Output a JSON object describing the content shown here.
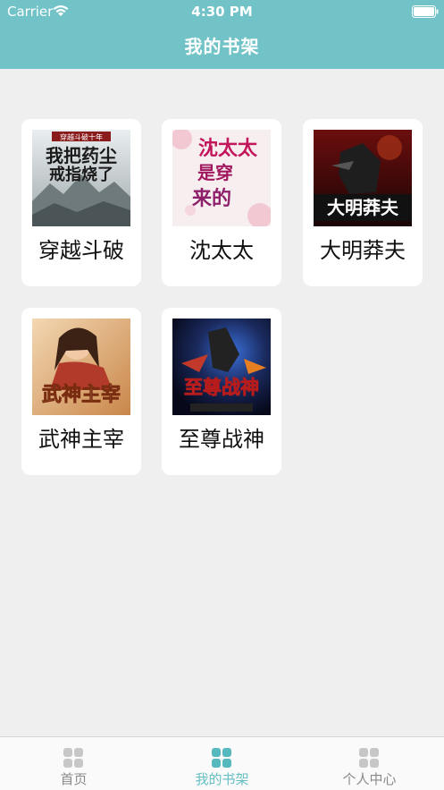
{
  "status_bar": {
    "carrier": "Carrier",
    "time": "4:30 PM"
  },
  "header": {
    "title": "我的书架"
  },
  "books": [
    {
      "title": "穿越斗破",
      "cover_text": "我把药尘戒指烧了",
      "cover_top": "穿越斗破十年"
    },
    {
      "title": "沈太太",
      "cover_text": "沈太太是穿来的"
    },
    {
      "title": "大明莽夫",
      "cover_text": "大明莽夫"
    },
    {
      "title": "武神主宰",
      "cover_text": "武神主宰"
    },
    {
      "title": "至尊战神",
      "cover_text": "至尊战神"
    }
  ],
  "tabbar": {
    "items": [
      {
        "label": "首页",
        "active": false
      },
      {
        "label": "我的书架",
        "active": true
      },
      {
        "label": "个人中心",
        "active": false
      }
    ]
  },
  "colors": {
    "header": "#72c3c7",
    "active_tab": "#66bfc3",
    "inactive_tab": "#8a8a8a",
    "background": "#efefef"
  }
}
